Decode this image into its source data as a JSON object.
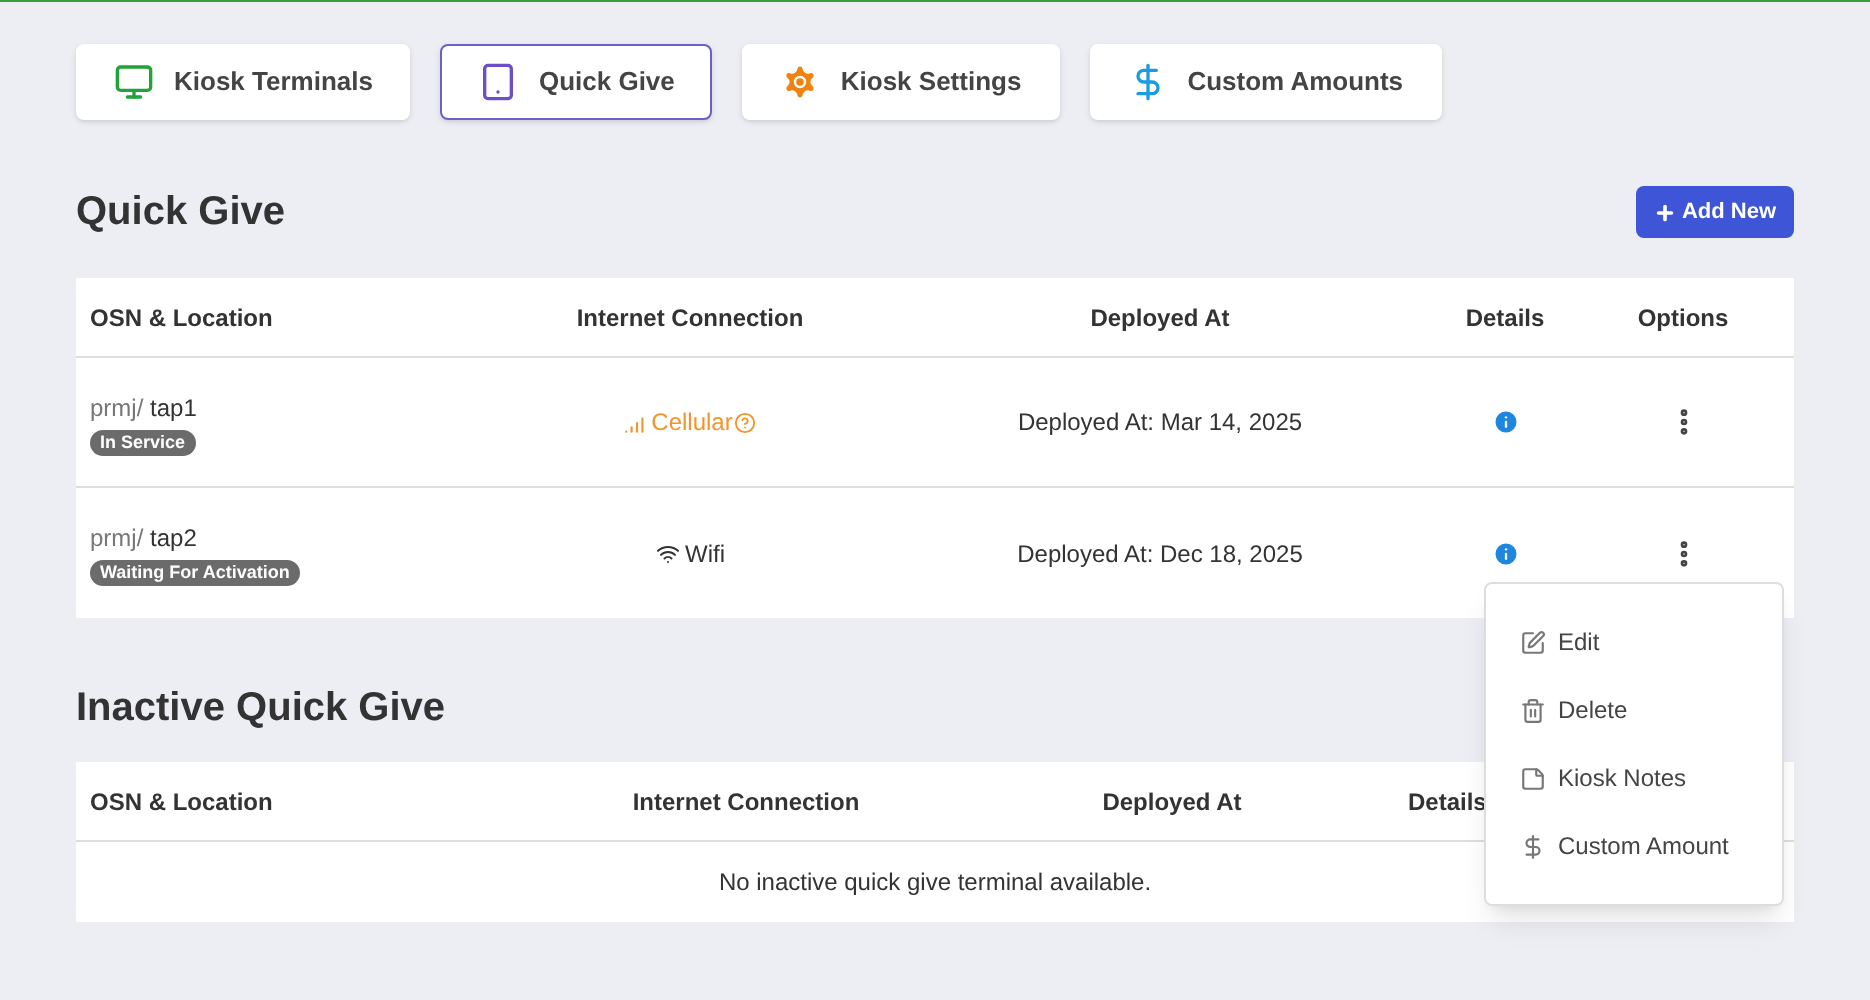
{
  "tabs": [
    {
      "label": "Kiosk Terminals",
      "kind": "monitor",
      "selected": false
    },
    {
      "label": "Quick Give",
      "kind": "tablet",
      "selected": true
    },
    {
      "label": "Kiosk Settings",
      "kind": "gear",
      "selected": false
    },
    {
      "label": "Custom Amounts",
      "kind": "dollar",
      "selected": false
    }
  ],
  "active": {
    "title": "Quick Give",
    "add_button": "Add New",
    "columns": [
      "OSN & Location",
      "Internet Connection",
      "Deployed At",
      "Details",
      "Options"
    ],
    "rows": [
      {
        "prefix": "prmj/",
        "name": "tap1",
        "status": "In Service",
        "connection": {
          "kind": "cellular",
          "label": "Cellular"
        },
        "deployed": "Deployed At: Mar 14, 2025"
      },
      {
        "prefix": "prmj/",
        "name": "tap2",
        "status": "Waiting For Activation",
        "connection": {
          "kind": "wifi",
          "label": "Wifi"
        },
        "deployed": "Deployed At: Dec 18, 2025"
      }
    ]
  },
  "inactive": {
    "title": "Inactive Quick Give",
    "columns": [
      "OSN & Location",
      "Internet Connection",
      "Deployed At",
      "Details"
    ],
    "empty": "No inactive quick give terminal available."
  },
  "menu": [
    {
      "kind": "edit",
      "label": "Edit"
    },
    {
      "kind": "trash",
      "label": "Delete"
    },
    {
      "kind": "note",
      "label": "Kiosk Notes"
    },
    {
      "kind": "dollar",
      "label": "Custom Amount"
    }
  ]
}
